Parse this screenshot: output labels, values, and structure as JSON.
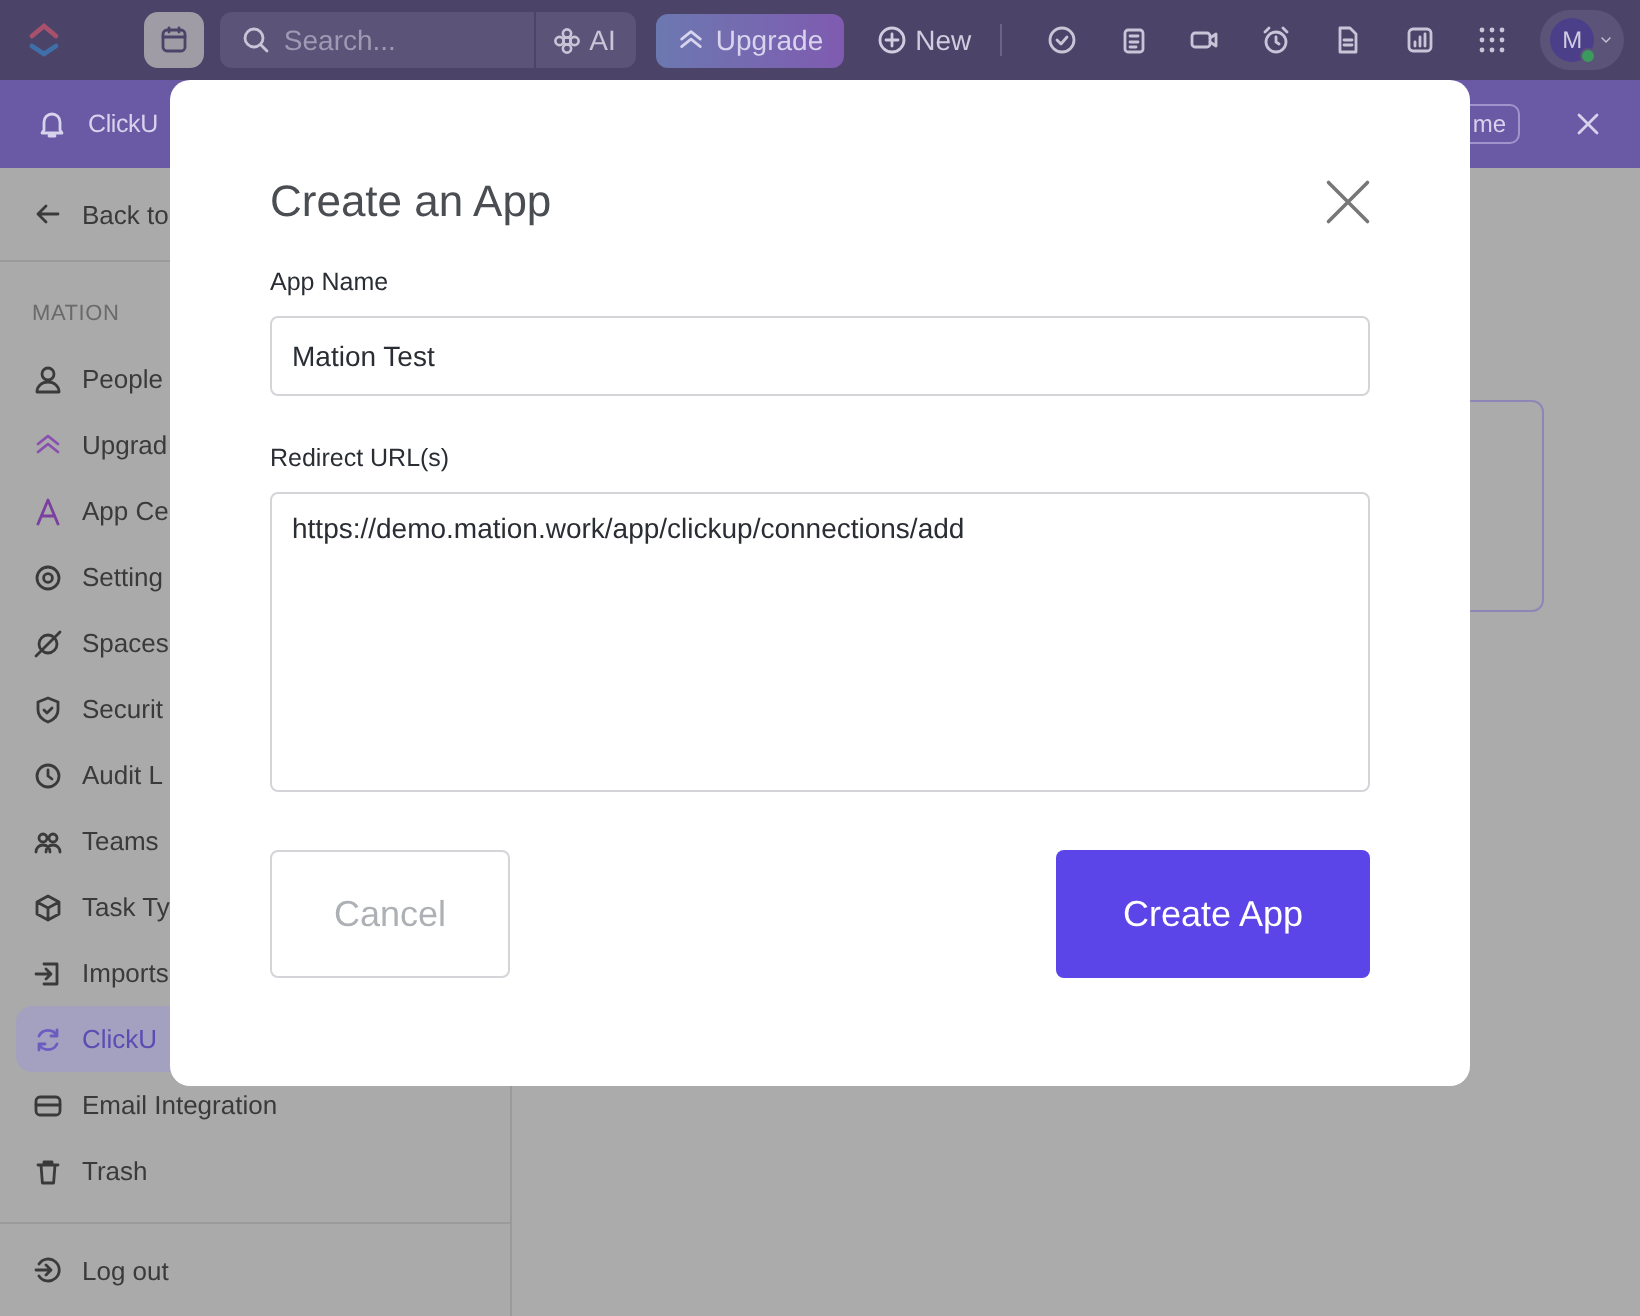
{
  "topbar": {
    "search": {
      "placeholder": "Search..."
    },
    "ai_label": "AI",
    "upgrade": "Upgrade",
    "new": "New",
    "avatar": "M"
  },
  "banner": {
    "text": "ClickU",
    "button": "me"
  },
  "sidebar": {
    "back": "Back to",
    "section": "MATION",
    "items": [
      {
        "label": "People",
        "selected": false
      },
      {
        "label": "Upgrad",
        "selected": false
      },
      {
        "label": "App Ce",
        "selected": false
      },
      {
        "label": "Setting",
        "selected": false
      },
      {
        "label": "Spaces",
        "selected": false
      },
      {
        "label": "Securit",
        "selected": false
      },
      {
        "label": "Audit L",
        "selected": false
      },
      {
        "label": "Teams",
        "selected": false
      },
      {
        "label": "Task Ty",
        "selected": false
      },
      {
        "label": "Imports",
        "selected": false
      },
      {
        "label": "ClickU",
        "selected": true
      },
      {
        "label": "Email Integration",
        "selected": false
      },
      {
        "label": "Trash",
        "selected": false
      }
    ],
    "logout": "Log out"
  },
  "modal": {
    "title": "Create an App",
    "fields": [
      {
        "label": "App Name",
        "value": "Mation Test",
        "kind": "input"
      },
      {
        "label": "Redirect URL(s)",
        "value": "https://demo.mation.work/app/clickup/connections/add",
        "kind": "textarea"
      }
    ],
    "cancel": "Cancel",
    "submit": "Create App"
  }
}
